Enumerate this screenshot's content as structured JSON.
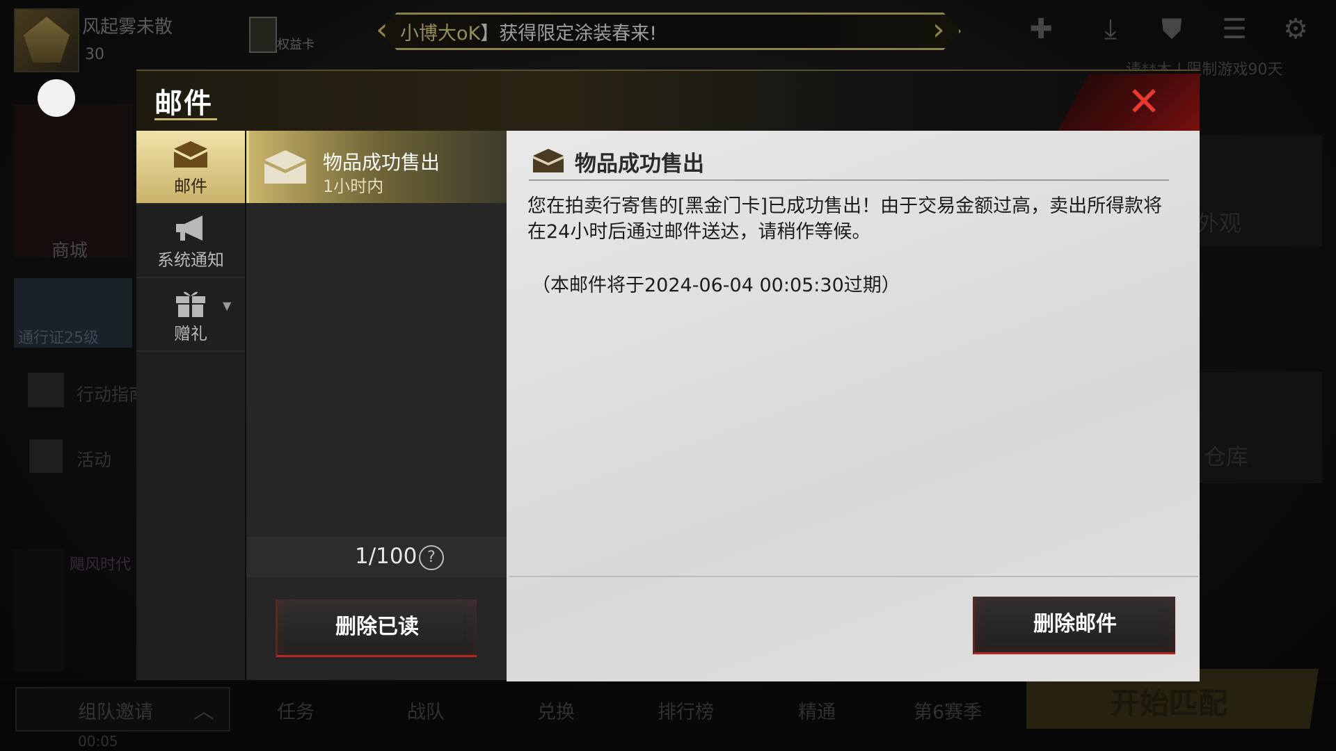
{
  "background": {
    "player_name": "风起雾未散",
    "player_level": "30",
    "benefit_card_label": "权益卡",
    "marquee": {
      "highlight": "小博大oK",
      "text": "】获得限定涂装春来!"
    },
    "account_limit": "请**木 | 限制游戏90天",
    "shop_label": "商城",
    "pass_label": "通行证25级",
    "guide_label": "行动指南",
    "activity_label": "活动",
    "chat_title": "飓风时代",
    "right_label_1": "外观",
    "right_label_2": "仓库",
    "team_invite": "组队邀请",
    "bottom_nav": [
      "任务",
      "战队",
      "兑换",
      "排行榜",
      "精通",
      "第6赛季"
    ],
    "start_match": "开始匹配",
    "clock": "00:05"
  },
  "dialog": {
    "title": "邮件",
    "categories": [
      {
        "label": "邮件",
        "icon": "envelope-icon",
        "active": true
      },
      {
        "label": "系统通知",
        "icon": "megaphone-icon",
        "active": false
      },
      {
        "label": "赠礼",
        "icon": "gift-icon",
        "active": false
      }
    ],
    "mail_list": [
      {
        "title": "物品成功售出",
        "time": "1小时内",
        "selected": true
      }
    ],
    "count": "1/100",
    "delete_read_label": "删除已读",
    "content": {
      "title": "物品成功售出",
      "body": "您在拍卖行寄售的[黑金门卡]已成功售出！由于交易金额过高，卖出所得款将在24小时后通过邮件送达，请稍作等候。",
      "expire": "（本邮件将于2024-06-04 00:05:30过期）"
    },
    "delete_mail_label": "删除邮件"
  },
  "colors": {
    "accent_gold": "#d8c774",
    "close_red": "#e63a2f",
    "button_red_edge": "#b32a22"
  }
}
